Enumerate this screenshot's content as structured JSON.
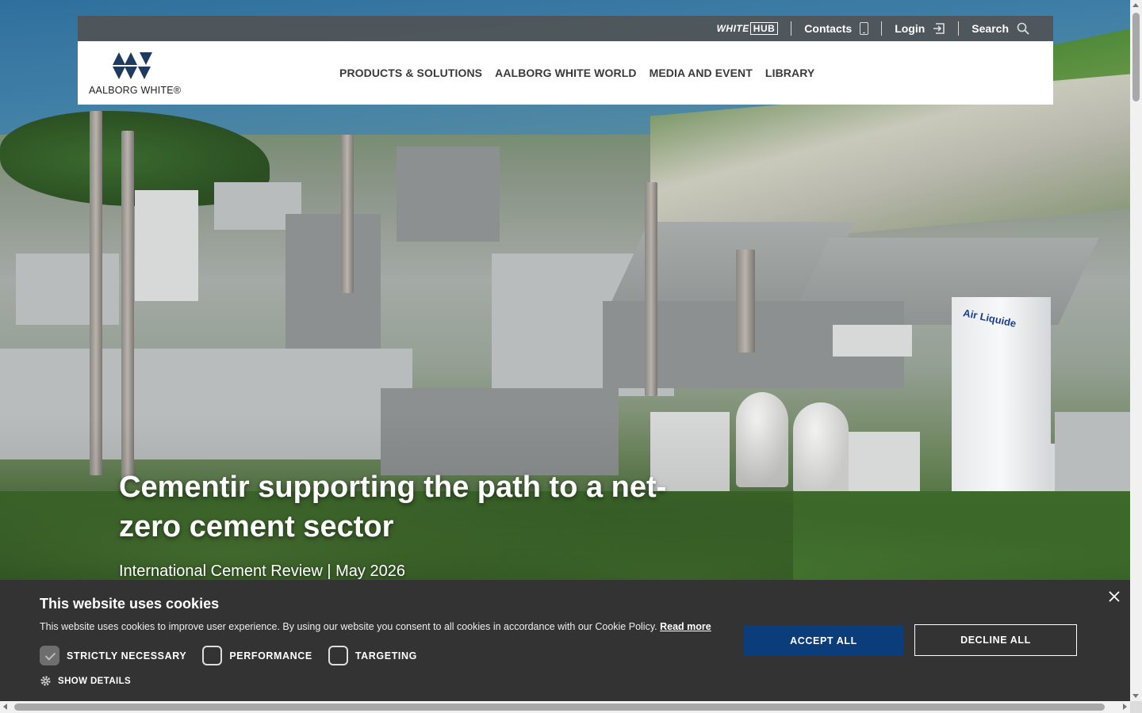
{
  "topbar": {
    "whitehub_white": "WHITE",
    "whitehub_hub": "HUB",
    "contacts_label": "Contacts",
    "login_label": "Login",
    "search_label": "Search"
  },
  "brand": {
    "logo_text": "AALBORG WHITE®",
    "tower_text": "Air Liquide"
  },
  "nav": {
    "items": [
      {
        "label": "PRODUCTS & SOLUTIONS"
      },
      {
        "label": "AALBORG WHITE WORLD"
      },
      {
        "label": "MEDIA AND EVENT"
      },
      {
        "label": "LIBRARY"
      }
    ]
  },
  "hero": {
    "title": "Cementir supporting the path to a net-zero cement sector",
    "subtitle": "International Cement Review | May 2026"
  },
  "cookie": {
    "title": "This website uses cookies",
    "text": "This website uses cookies to improve user experience. By using our website you consent to all cookies in accordance with our Cookie Policy.",
    "read_more": "Read more",
    "options": [
      {
        "label": "STRICTLY NECESSARY",
        "checked": true
      },
      {
        "label": "PERFORMANCE",
        "checked": false
      },
      {
        "label": "TARGETING",
        "checked": false
      }
    ],
    "show_details": "SHOW DETAILS",
    "accept_label": "ACCEPT ALL",
    "decline_label": "DECLINE ALL"
  },
  "colors": {
    "accent_button": "#0a3d7a",
    "banner_bg": "#333333",
    "nav_text": "#3a3a3a",
    "logo_blue": "#1f3a5f"
  },
  "icons": {
    "contacts": "phone-icon",
    "login": "login-icon",
    "search": "search-icon",
    "close": "close-icon",
    "details": "gear-icon"
  }
}
